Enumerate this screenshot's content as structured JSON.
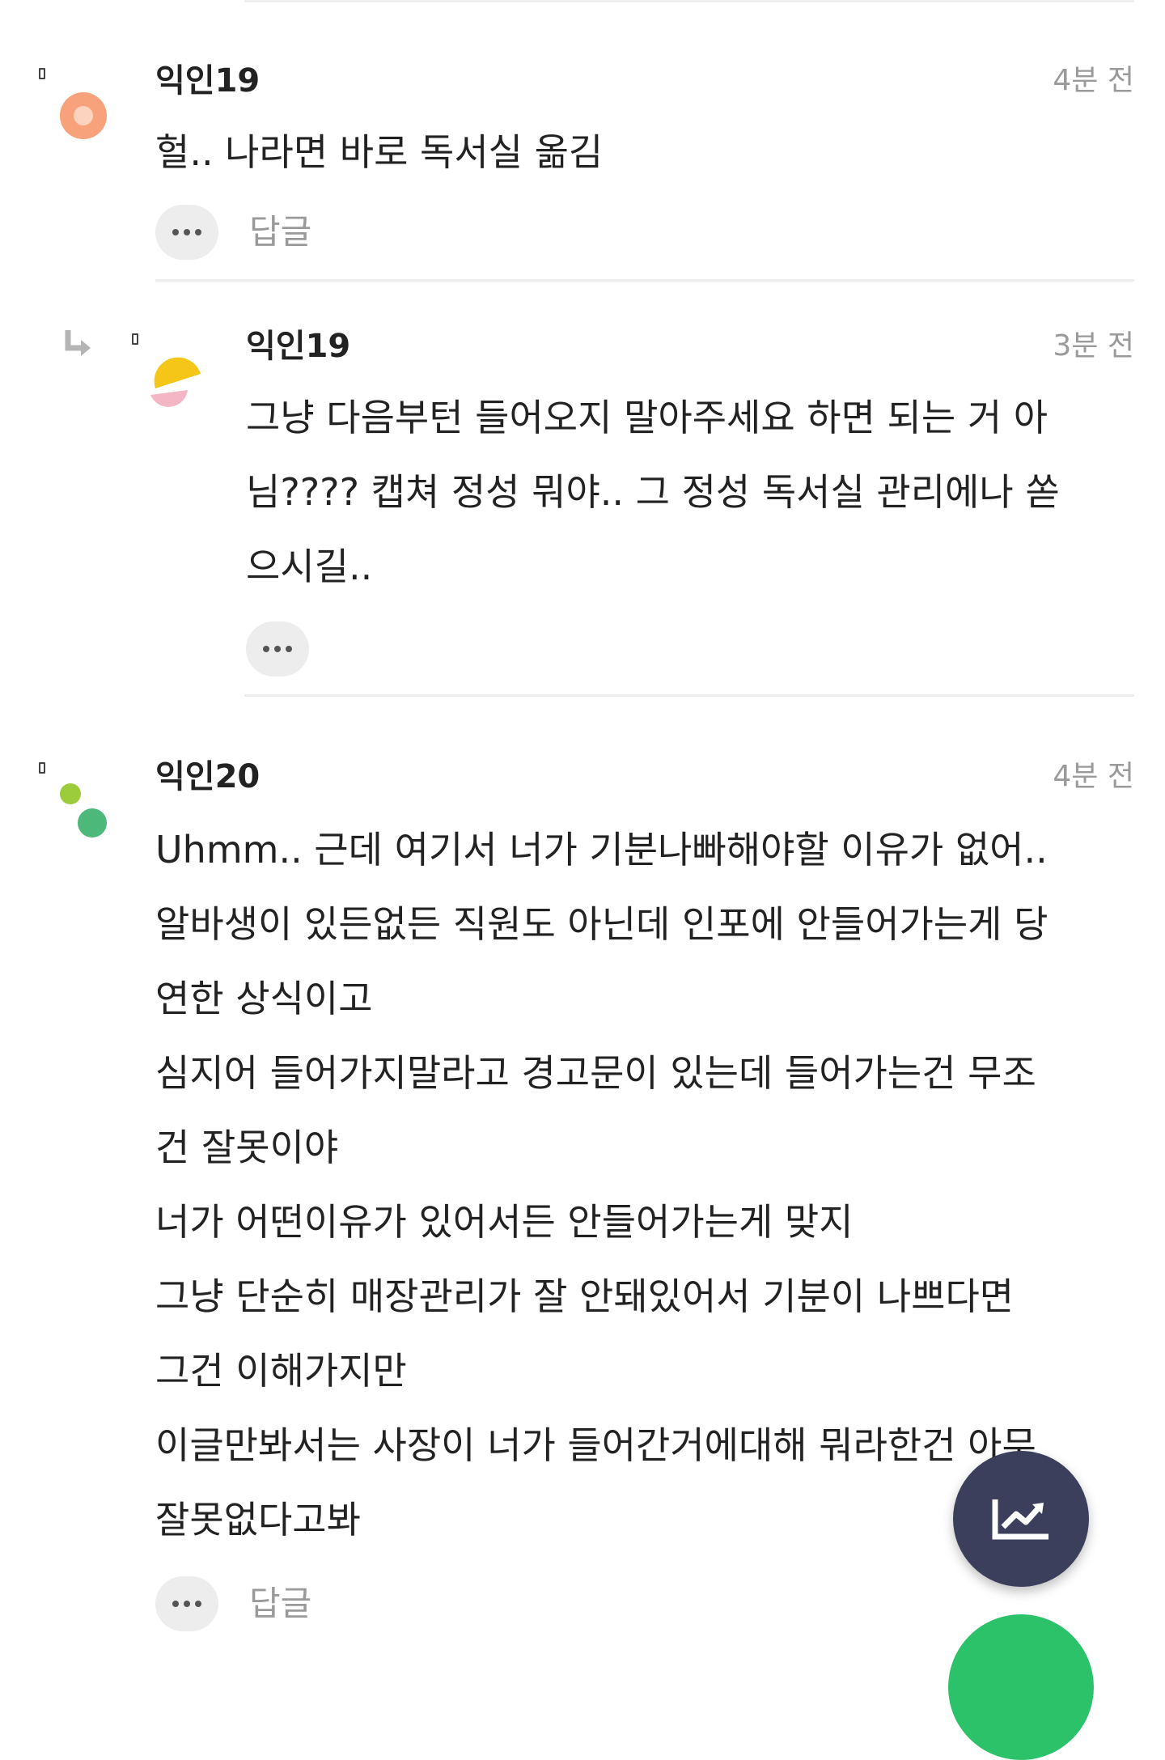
{
  "comments": [
    {
      "author": "익인19",
      "time": "4분 전",
      "lines": [
        "헐.. 나라면 바로 독서실 옮김"
      ],
      "reply_label": "답글",
      "avatar_icon": "avatar-orange-ring-icon"
    },
    {
      "author": "익인19",
      "time": "3분 전",
      "lines": [
        "그냥 다음부턴 들어오지 말아주세요 하면 되는 거 아",
        "님???? 캡쳐 정성 뭐야.. 그 정성 독서실 관리에나 쏟",
        "으시길.."
      ],
      "is_reply": true,
      "reply_arrow_icon": "reply-arrow-icon",
      "avatar_icon": "avatar-yellow-pink-icon"
    },
    {
      "author": "익인20",
      "time": "4분 전",
      "lines": [
        "Uhmm.. 근데 여기서 너가 기분나빠해야할 이유가 없어..",
        "알바생이 있든없든 직원도 아닌데 인포에 안들어가는게 당",
        "연한 상식이고",
        "심지어 들어가지말라고 경고문이 있는데 들어가는건 무조",
        "건 잘못이야",
        "너가 어떤이유가 있어서든 안들어가는게 맞지",
        "그냥 단순히 매장관리가 잘 안돼있어서 기분이 나쁘다면",
        "그건 이해가지만",
        "이글만봐서는 사장이 너가 들어간거에대해 뭐라한건 아무",
        "잘못없다고봐"
      ],
      "reply_label": "답글",
      "avatar_icon": "avatar-green-dots-icon"
    }
  ],
  "fab_icon": "trend-chart-icon",
  "colors": {
    "fab": "#3b3f5c",
    "fab_secondary": "#2bc26a",
    "time": "#9a9a9a",
    "divider": "#eeeeee"
  }
}
